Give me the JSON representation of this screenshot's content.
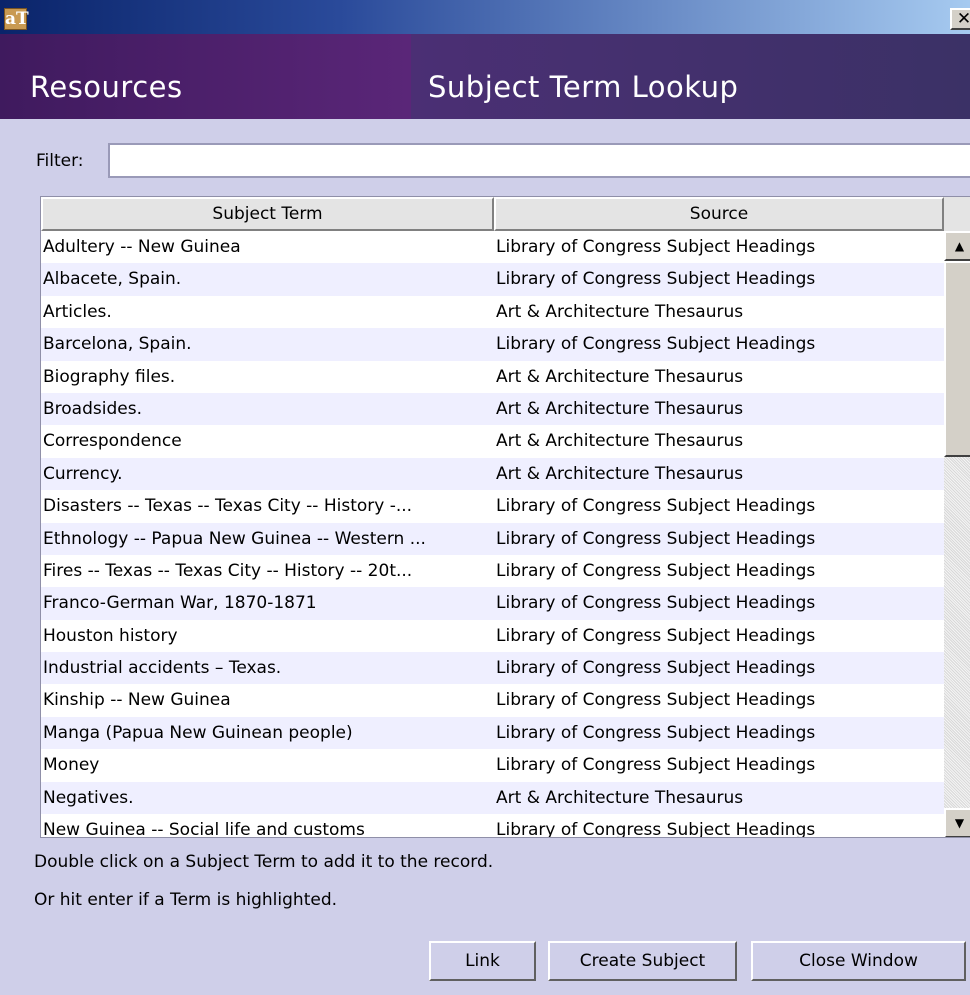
{
  "titlebar": {
    "app_icon_text": "aT",
    "close_symbol": "✕"
  },
  "header": {
    "left_title": "Resources",
    "right_title": "Subject Term Lookup"
  },
  "filter": {
    "label": "Filter:",
    "value": ""
  },
  "table": {
    "columns": [
      "Subject Term",
      "Source"
    ],
    "rows": [
      {
        "subject": "Adultery -- New Guinea",
        "source": "Library of Congress Subject Headings"
      },
      {
        "subject": "Albacete, Spain.",
        "source": "Library of Congress Subject Headings"
      },
      {
        "subject": "Articles.",
        "source": "Art & Architecture Thesaurus"
      },
      {
        "subject": "Barcelona, Spain.",
        "source": "Library of Congress Subject Headings"
      },
      {
        "subject": "Biography files.",
        "source": "Art & Architecture Thesaurus"
      },
      {
        "subject": "Broadsides.",
        "source": "Art & Architecture Thesaurus"
      },
      {
        "subject": "Correspondence",
        "source": "Art & Architecture Thesaurus"
      },
      {
        "subject": "Currency.",
        "source": "Art & Architecture Thesaurus"
      },
      {
        "subject": "Disasters -- Texas -- Texas City -- History -...",
        "source": "Library of Congress Subject Headings"
      },
      {
        "subject": "Ethnology -- Papua New Guinea -- Western ...",
        "source": "Library of Congress Subject Headings"
      },
      {
        "subject": "Fires -- Texas -- Texas City -- History -- 20t...",
        "source": "Library of Congress Subject Headings"
      },
      {
        "subject": "Franco-German War, 1870-1871",
        "source": "Library of Congress Subject Headings"
      },
      {
        "subject": "Houston history",
        "source": "Library of Congress Subject Headings"
      },
      {
        "subject": "Industrial accidents – Texas.",
        "source": "Library of Congress Subject Headings"
      },
      {
        "subject": "Kinship -- New Guinea",
        "source": "Library of Congress Subject Headings"
      },
      {
        "subject": "Manga (Papua New Guinean people)",
        "source": "Library of Congress Subject Headings"
      },
      {
        "subject": "Money",
        "source": "Library of Congress Subject Headings"
      },
      {
        "subject": "Negatives.",
        "source": "Art & Architecture Thesaurus"
      },
      {
        "subject": "New Guinea -- Social life and customs",
        "source": "Library of Congress Subject Headings"
      }
    ]
  },
  "scrollbar": {
    "up_symbol": "▲",
    "down_symbol": "▼"
  },
  "hints": {
    "line1": "Double click on a Subject Term to add it to the record.",
    "line2": "Or hit enter if a Term is highlighted."
  },
  "buttons": {
    "link": "Link",
    "create_subject": "Create Subject",
    "close_window": "Close Window"
  }
}
